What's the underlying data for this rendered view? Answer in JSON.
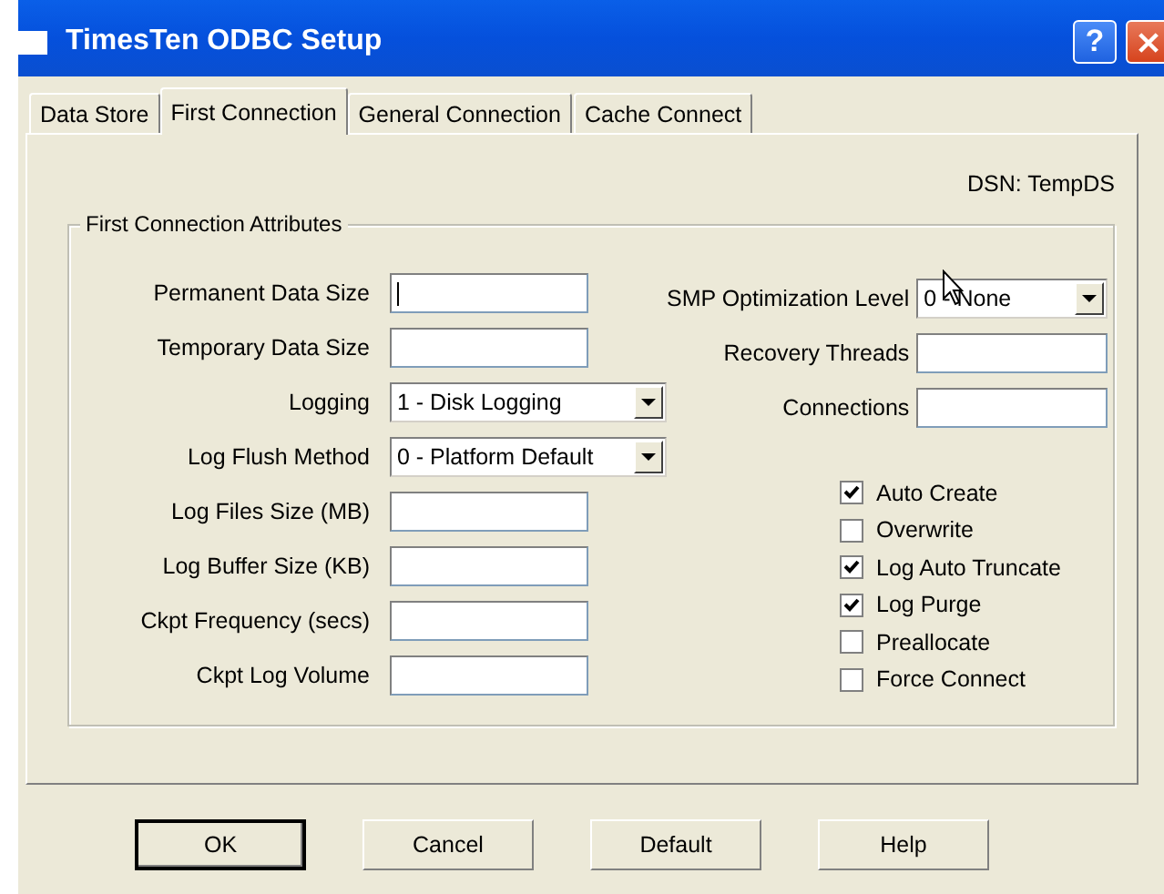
{
  "window": {
    "title": "TimesTen ODBC Setup",
    "help_button": "?"
  },
  "tabs": [
    {
      "label": "Data Store",
      "selected": false
    },
    {
      "label": "First Connection",
      "selected": true
    },
    {
      "label": "General Connection",
      "selected": false
    },
    {
      "label": "Cache Connect",
      "selected": false
    }
  ],
  "dsn_label": "DSN: TempDS",
  "group": {
    "title": "First Connection Attributes",
    "left_fields": [
      {
        "kind": "text",
        "label": "Permanent Data Size",
        "focused": true
      },
      {
        "kind": "text",
        "label": "Temporary Data Size",
        "focused": false
      },
      {
        "kind": "combo",
        "label": "Logging",
        "value": "1 - Disk Logging"
      },
      {
        "kind": "combo",
        "label": "Log Flush Method",
        "value": "0 - Platform Default"
      },
      {
        "kind": "text",
        "label": "Log Files Size (MB)",
        "focused": false
      },
      {
        "kind": "text",
        "label": "Log Buffer Size (KB)",
        "focused": false
      },
      {
        "kind": "text",
        "label": "Ckpt Frequency (secs)",
        "focused": false
      },
      {
        "kind": "text",
        "label": "Ckpt Log Volume",
        "focused": false
      }
    ],
    "right_fields": [
      {
        "kind": "combo",
        "label": "SMP Optimization Level",
        "value": "0 - None"
      },
      {
        "kind": "text",
        "label": "Recovery Threads",
        "focused": false
      },
      {
        "kind": "text",
        "label": "Connections",
        "focused": false
      }
    ],
    "checkboxes": [
      {
        "label": "Auto Create",
        "checked": true
      },
      {
        "label": "Overwrite",
        "checked": false
      },
      {
        "label": "Log Auto Truncate",
        "checked": true
      },
      {
        "label": "Log Purge",
        "checked": true
      },
      {
        "label": "Preallocate",
        "checked": false
      },
      {
        "label": "Force Connect",
        "checked": false
      }
    ]
  },
  "buttons": [
    {
      "label": "OK",
      "default": true
    },
    {
      "label": "Cancel",
      "default": false
    },
    {
      "label": "Default",
      "default": false
    },
    {
      "label": "Help",
      "default": false
    }
  ]
}
